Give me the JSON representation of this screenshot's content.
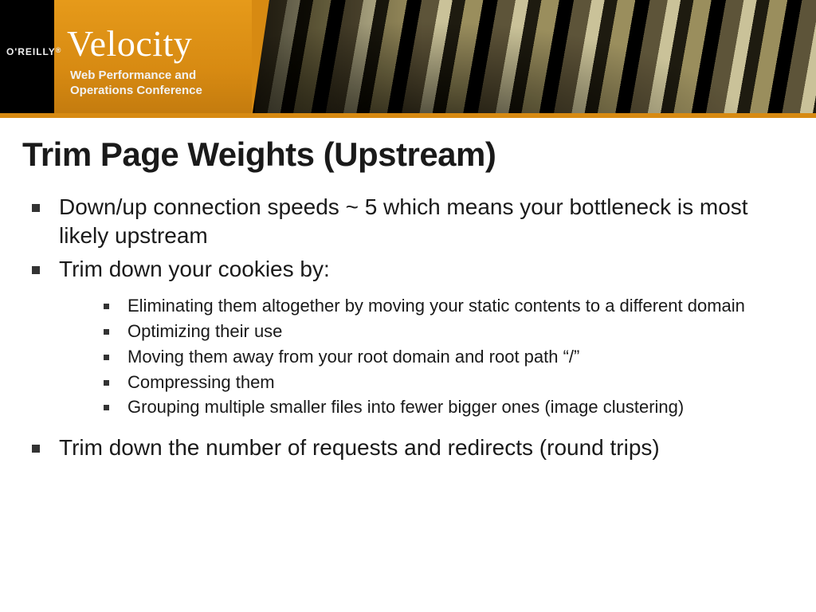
{
  "banner": {
    "brand": "O'REILLY",
    "logo": "Velocity",
    "tagline_line1": "Web Performance and",
    "tagline_line2": "Operations Conference"
  },
  "slide": {
    "title": "Trim Page Weights (Upstream)",
    "bullets_top": [
      "Down/up connection speeds ~ 5 which means your bottleneck is most likely upstream",
      "Trim down your cookies by:"
    ],
    "sub_bullets": [
      "Eliminating them altogether by moving your static contents to a different domain",
      "Optimizing their use",
      "Moving them away from your root domain and root path “/”",
      "Compressing them",
      "Grouping multiple smaller files into fewer bigger ones (image clustering)"
    ],
    "bullets_bottom": [
      "Trim down the number of requests and redirects (round trips)"
    ]
  }
}
